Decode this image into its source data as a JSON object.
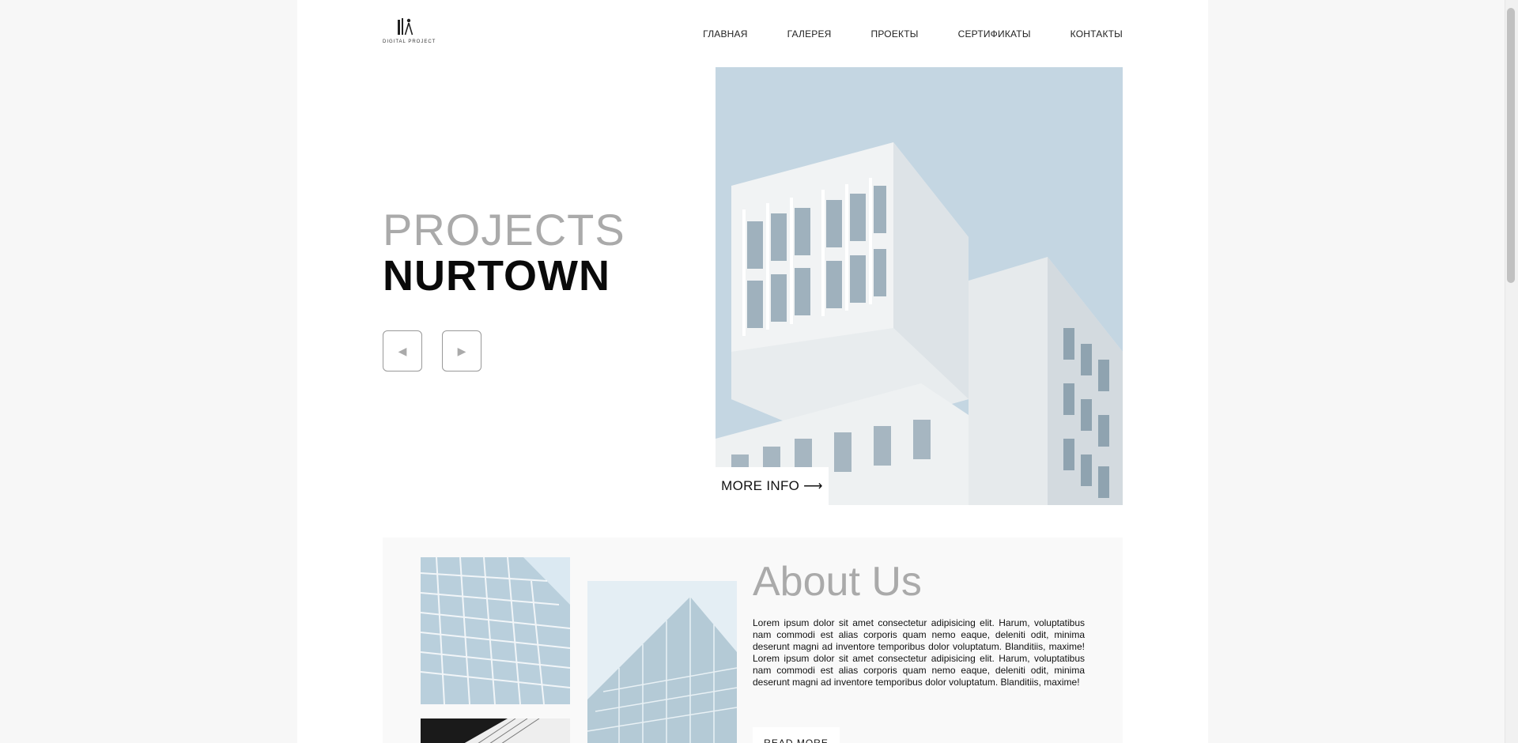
{
  "logo": {
    "text": "DIGITAL PROJECT"
  },
  "nav": {
    "items": [
      "ГЛАВНАЯ",
      "ГАЛЕРЕЯ",
      "ПРОЕКТЫ",
      "СЕРТИФИКАТЫ",
      "КОНТАКТЫ"
    ]
  },
  "hero": {
    "title_light": "PROJECTS",
    "title_bold": "NURTOWN",
    "prev_label": "◀",
    "next_label": "▶",
    "more_info": "MORE INFO ⟶"
  },
  "about": {
    "title": "About Us",
    "text": "Lorem ipsum dolor sit amet consectetur adipisicing elit. Harum, voluptatibus nam commodi est alias corporis quam nemo eaque, deleniti odit, minima deserunt magni ad inventore temporibus dolor voluptatum. Blanditiis, maxime! Lorem ipsum dolor sit amet consectetur adipisicing elit. Harum, voluptatibus nam commodi est alias corporis quam nemo eaque, deleniti odit, minima deserunt magni ad inventore temporibus dolor voluptatum. Blanditiis, maxime!",
    "read_more": "READ MORE"
  },
  "colors": {
    "sky": "#c4d6e2",
    "building": "#eef0f1",
    "title_gray": "#aaaaaa"
  }
}
